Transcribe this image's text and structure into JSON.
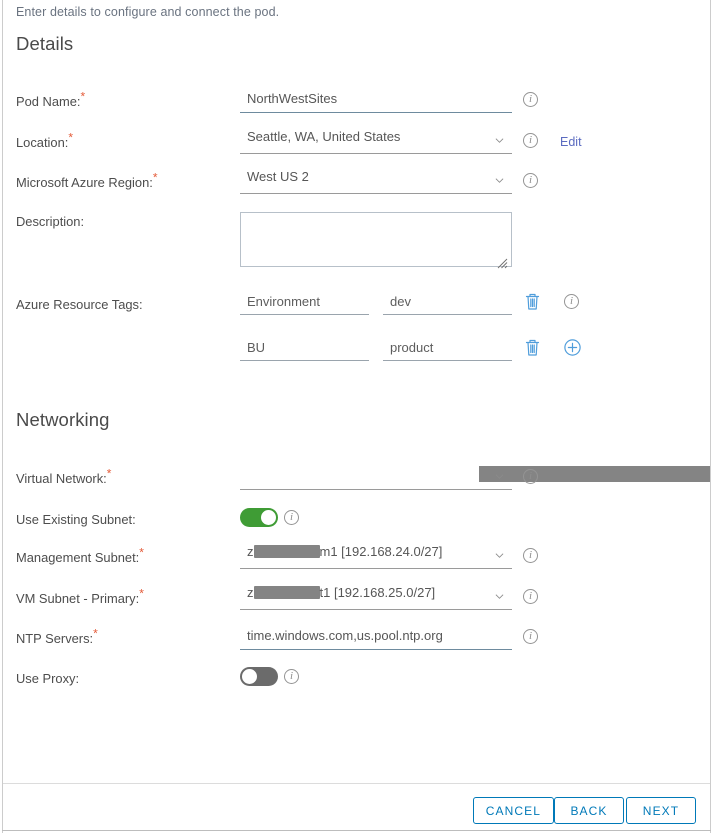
{
  "dialog": {
    "intro": "Enter details to configure and connect the pod."
  },
  "sections": {
    "details": {
      "title": "Details"
    },
    "networking": {
      "title": "Networking"
    }
  },
  "details": {
    "pod_name": {
      "label": "Pod Name:",
      "required": true,
      "value": "NorthWestSites",
      "placeholder": ""
    },
    "location": {
      "label": "Location:",
      "required": true,
      "value": "Seattle, WA, United States",
      "edit_link": "Edit"
    },
    "azure_region": {
      "label": "Microsoft Azure Region:",
      "required": true,
      "value": "West US 2"
    },
    "description": {
      "label": "Description:",
      "required": false,
      "value": "",
      "placeholder": ""
    },
    "resource_tags": {
      "label": "Azure Resource Tags:",
      "rows": [
        {
          "key": "Environment",
          "value": "dev"
        },
        {
          "key": "BU",
          "value": "product"
        }
      ]
    }
  },
  "networking": {
    "virtual_network": {
      "label": "Virtual Network:",
      "required": true,
      "value": "",
      "redacted": true
    },
    "use_existing_subnet": {
      "label": "Use Existing Subnet:",
      "state": "on"
    },
    "management_subnet": {
      "label": "Management Subnet:",
      "required": true,
      "value_prefix": "z",
      "value_suffix": "m1 [192.168.24.0/27]"
    },
    "vm_subnet_primary": {
      "label": "VM Subnet - Primary:",
      "required": true,
      "value_prefix": "z",
      "value_suffix": "t1 [192.168.25.0/27]"
    },
    "ntp_servers": {
      "label": "NTP Servers:",
      "required": true,
      "value": "time.windows.com,us.pool.ntp.org"
    },
    "use_proxy": {
      "label": "Use Proxy:",
      "state": "off"
    }
  },
  "icons": {
    "info": "i"
  },
  "footer": {
    "cancel": "CANCEL",
    "back": "BACK",
    "next": "NEXT"
  },
  "colors": {
    "accent": "#0079b8",
    "required_asterisk": "#e45b39",
    "toggle_on": "#3f9c35",
    "toggle_off": "#6b6b6b",
    "link": "#5b6bc0",
    "redaction": "#848484"
  }
}
